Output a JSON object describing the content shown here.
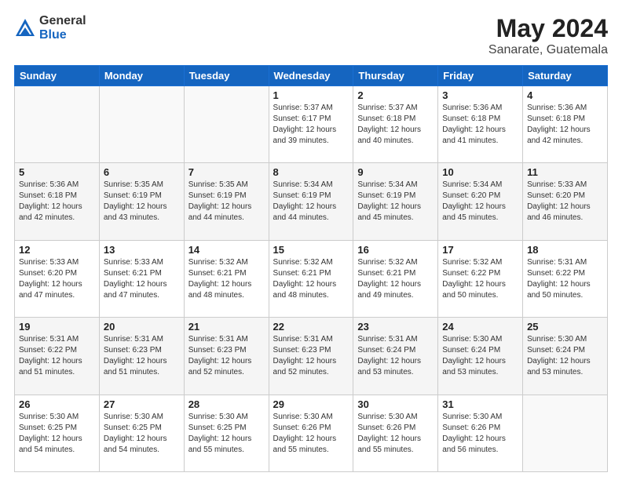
{
  "header": {
    "logo_general": "General",
    "logo_blue": "Blue",
    "title": "May 2024",
    "location": "Sanarate, Guatemala"
  },
  "days_of_week": [
    "Sunday",
    "Monday",
    "Tuesday",
    "Wednesday",
    "Thursday",
    "Friday",
    "Saturday"
  ],
  "weeks": [
    {
      "shade": false,
      "days": [
        {
          "num": "",
          "sunrise": "",
          "sunset": "",
          "daylight": ""
        },
        {
          "num": "",
          "sunrise": "",
          "sunset": "",
          "daylight": ""
        },
        {
          "num": "",
          "sunrise": "",
          "sunset": "",
          "daylight": ""
        },
        {
          "num": "1",
          "sunrise": "Sunrise: 5:37 AM",
          "sunset": "Sunset: 6:17 PM",
          "daylight": "Daylight: 12 hours and 39 minutes."
        },
        {
          "num": "2",
          "sunrise": "Sunrise: 5:37 AM",
          "sunset": "Sunset: 6:18 PM",
          "daylight": "Daylight: 12 hours and 40 minutes."
        },
        {
          "num": "3",
          "sunrise": "Sunrise: 5:36 AM",
          "sunset": "Sunset: 6:18 PM",
          "daylight": "Daylight: 12 hours and 41 minutes."
        },
        {
          "num": "4",
          "sunrise": "Sunrise: 5:36 AM",
          "sunset": "Sunset: 6:18 PM",
          "daylight": "Daylight: 12 hours and 42 minutes."
        }
      ]
    },
    {
      "shade": true,
      "days": [
        {
          "num": "5",
          "sunrise": "Sunrise: 5:36 AM",
          "sunset": "Sunset: 6:18 PM",
          "daylight": "Daylight: 12 hours and 42 minutes."
        },
        {
          "num": "6",
          "sunrise": "Sunrise: 5:35 AM",
          "sunset": "Sunset: 6:19 PM",
          "daylight": "Daylight: 12 hours and 43 minutes."
        },
        {
          "num": "7",
          "sunrise": "Sunrise: 5:35 AM",
          "sunset": "Sunset: 6:19 PM",
          "daylight": "Daylight: 12 hours and 44 minutes."
        },
        {
          "num": "8",
          "sunrise": "Sunrise: 5:34 AM",
          "sunset": "Sunset: 6:19 PM",
          "daylight": "Daylight: 12 hours and 44 minutes."
        },
        {
          "num": "9",
          "sunrise": "Sunrise: 5:34 AM",
          "sunset": "Sunset: 6:19 PM",
          "daylight": "Daylight: 12 hours and 45 minutes."
        },
        {
          "num": "10",
          "sunrise": "Sunrise: 5:34 AM",
          "sunset": "Sunset: 6:20 PM",
          "daylight": "Daylight: 12 hours and 45 minutes."
        },
        {
          "num": "11",
          "sunrise": "Sunrise: 5:33 AM",
          "sunset": "Sunset: 6:20 PM",
          "daylight": "Daylight: 12 hours and 46 minutes."
        }
      ]
    },
    {
      "shade": false,
      "days": [
        {
          "num": "12",
          "sunrise": "Sunrise: 5:33 AM",
          "sunset": "Sunset: 6:20 PM",
          "daylight": "Daylight: 12 hours and 47 minutes."
        },
        {
          "num": "13",
          "sunrise": "Sunrise: 5:33 AM",
          "sunset": "Sunset: 6:21 PM",
          "daylight": "Daylight: 12 hours and 47 minutes."
        },
        {
          "num": "14",
          "sunrise": "Sunrise: 5:32 AM",
          "sunset": "Sunset: 6:21 PM",
          "daylight": "Daylight: 12 hours and 48 minutes."
        },
        {
          "num": "15",
          "sunrise": "Sunrise: 5:32 AM",
          "sunset": "Sunset: 6:21 PM",
          "daylight": "Daylight: 12 hours and 48 minutes."
        },
        {
          "num": "16",
          "sunrise": "Sunrise: 5:32 AM",
          "sunset": "Sunset: 6:21 PM",
          "daylight": "Daylight: 12 hours and 49 minutes."
        },
        {
          "num": "17",
          "sunrise": "Sunrise: 5:32 AM",
          "sunset": "Sunset: 6:22 PM",
          "daylight": "Daylight: 12 hours and 50 minutes."
        },
        {
          "num": "18",
          "sunrise": "Sunrise: 5:31 AM",
          "sunset": "Sunset: 6:22 PM",
          "daylight": "Daylight: 12 hours and 50 minutes."
        }
      ]
    },
    {
      "shade": true,
      "days": [
        {
          "num": "19",
          "sunrise": "Sunrise: 5:31 AM",
          "sunset": "Sunset: 6:22 PM",
          "daylight": "Daylight: 12 hours and 51 minutes."
        },
        {
          "num": "20",
          "sunrise": "Sunrise: 5:31 AM",
          "sunset": "Sunset: 6:23 PM",
          "daylight": "Daylight: 12 hours and 51 minutes."
        },
        {
          "num": "21",
          "sunrise": "Sunrise: 5:31 AM",
          "sunset": "Sunset: 6:23 PM",
          "daylight": "Daylight: 12 hours and 52 minutes."
        },
        {
          "num": "22",
          "sunrise": "Sunrise: 5:31 AM",
          "sunset": "Sunset: 6:23 PM",
          "daylight": "Daylight: 12 hours and 52 minutes."
        },
        {
          "num": "23",
          "sunrise": "Sunrise: 5:31 AM",
          "sunset": "Sunset: 6:24 PM",
          "daylight": "Daylight: 12 hours and 53 minutes."
        },
        {
          "num": "24",
          "sunrise": "Sunrise: 5:30 AM",
          "sunset": "Sunset: 6:24 PM",
          "daylight": "Daylight: 12 hours and 53 minutes."
        },
        {
          "num": "25",
          "sunrise": "Sunrise: 5:30 AM",
          "sunset": "Sunset: 6:24 PM",
          "daylight": "Daylight: 12 hours and 53 minutes."
        }
      ]
    },
    {
      "shade": false,
      "days": [
        {
          "num": "26",
          "sunrise": "Sunrise: 5:30 AM",
          "sunset": "Sunset: 6:25 PM",
          "daylight": "Daylight: 12 hours and 54 minutes."
        },
        {
          "num": "27",
          "sunrise": "Sunrise: 5:30 AM",
          "sunset": "Sunset: 6:25 PM",
          "daylight": "Daylight: 12 hours and 54 minutes."
        },
        {
          "num": "28",
          "sunrise": "Sunrise: 5:30 AM",
          "sunset": "Sunset: 6:25 PM",
          "daylight": "Daylight: 12 hours and 55 minutes."
        },
        {
          "num": "29",
          "sunrise": "Sunrise: 5:30 AM",
          "sunset": "Sunset: 6:26 PM",
          "daylight": "Daylight: 12 hours and 55 minutes."
        },
        {
          "num": "30",
          "sunrise": "Sunrise: 5:30 AM",
          "sunset": "Sunset: 6:26 PM",
          "daylight": "Daylight: 12 hours and 55 minutes."
        },
        {
          "num": "31",
          "sunrise": "Sunrise: 5:30 AM",
          "sunset": "Sunset: 6:26 PM",
          "daylight": "Daylight: 12 hours and 56 minutes."
        },
        {
          "num": "",
          "sunrise": "",
          "sunset": "",
          "daylight": ""
        }
      ]
    }
  ]
}
